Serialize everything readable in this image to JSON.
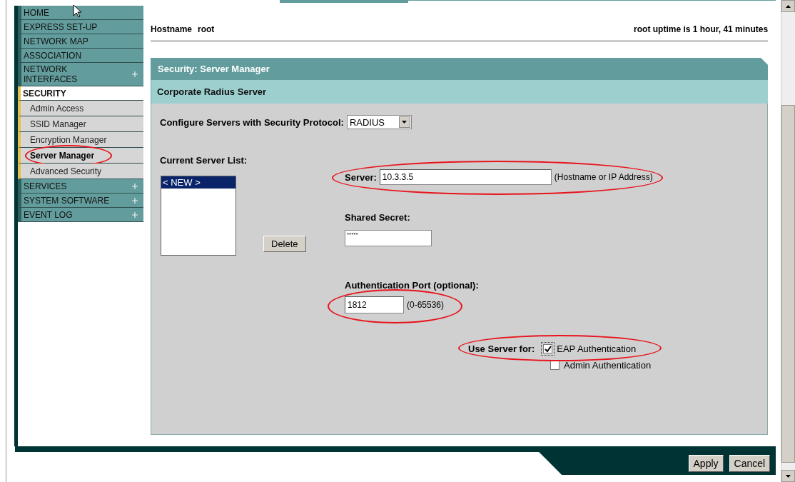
{
  "sidebar": {
    "items": [
      {
        "label": "HOME",
        "kind": "section",
        "expandable": false,
        "selected": false,
        "circled": false
      },
      {
        "label": "EXPRESS SET-UP",
        "kind": "section",
        "expandable": false,
        "selected": false,
        "circled": false
      },
      {
        "label": "NETWORK MAP",
        "kind": "section",
        "expandable": false,
        "selected": false,
        "circled": false
      },
      {
        "label": "ASSOCIATION",
        "kind": "section",
        "expandable": false,
        "selected": false,
        "circled": false
      },
      {
        "label": "NETWORK INTERFACES",
        "kind": "section",
        "expandable": true,
        "selected": false,
        "circled": false
      },
      {
        "label": "SECURITY",
        "kind": "section",
        "expandable": false,
        "selected": true,
        "circled": false
      },
      {
        "label": "Admin Access",
        "kind": "sub",
        "expandable": false,
        "selected": false,
        "circled": false
      },
      {
        "label": "SSID Manager",
        "kind": "sub",
        "expandable": false,
        "selected": false,
        "circled": false
      },
      {
        "label": "Encryption Manager",
        "kind": "sub",
        "expandable": false,
        "selected": false,
        "circled": false
      },
      {
        "label": "Server Manager",
        "kind": "sub",
        "expandable": false,
        "selected": true,
        "circled": true
      },
      {
        "label": "Advanced Security",
        "kind": "sub",
        "expandable": false,
        "selected": false,
        "circled": false
      },
      {
        "label": "SERVICES",
        "kind": "section",
        "expandable": true,
        "selected": false,
        "circled": false
      },
      {
        "label": "SYSTEM SOFTWARE",
        "kind": "section",
        "expandable": true,
        "selected": false,
        "circled": false
      },
      {
        "label": "EVENT LOG",
        "kind": "section",
        "expandable": true,
        "selected": false,
        "circled": false
      }
    ]
  },
  "header": {
    "hostname_label": "Hostname",
    "hostname": "root",
    "uptime": "root uptime is 1 hour, 41 minutes"
  },
  "panel": {
    "title": "Security: Server Manager",
    "subtitle": "Corporate Radius Server",
    "protocol": {
      "label": "Configure Servers with Security Protocol:",
      "value": "RADIUS"
    },
    "server_list": {
      "label": "Current Server List:",
      "items": [
        {
          "label": "< NEW >",
          "selected": true
        }
      ]
    },
    "delete_button": "Delete",
    "server": {
      "label": "Server:",
      "value": "10.3.3.5",
      "hint": "(Hostname or IP Address)",
      "circled": true
    },
    "shared_secret": {
      "label": "Shared Secret:",
      "value": "*****"
    },
    "auth_port": {
      "label": "Authentication Port (optional):",
      "value": "1812",
      "hint": "(0-65536)",
      "circled": true
    },
    "use_server": {
      "label": "Use Server for:",
      "circled": true,
      "options": [
        {
          "label": "EAP Authentication",
          "checked": true
        },
        {
          "label": "Admin Authentication",
          "checked": false
        }
      ]
    }
  },
  "buttons": [
    "Apply",
    "Cancel"
  ]
}
